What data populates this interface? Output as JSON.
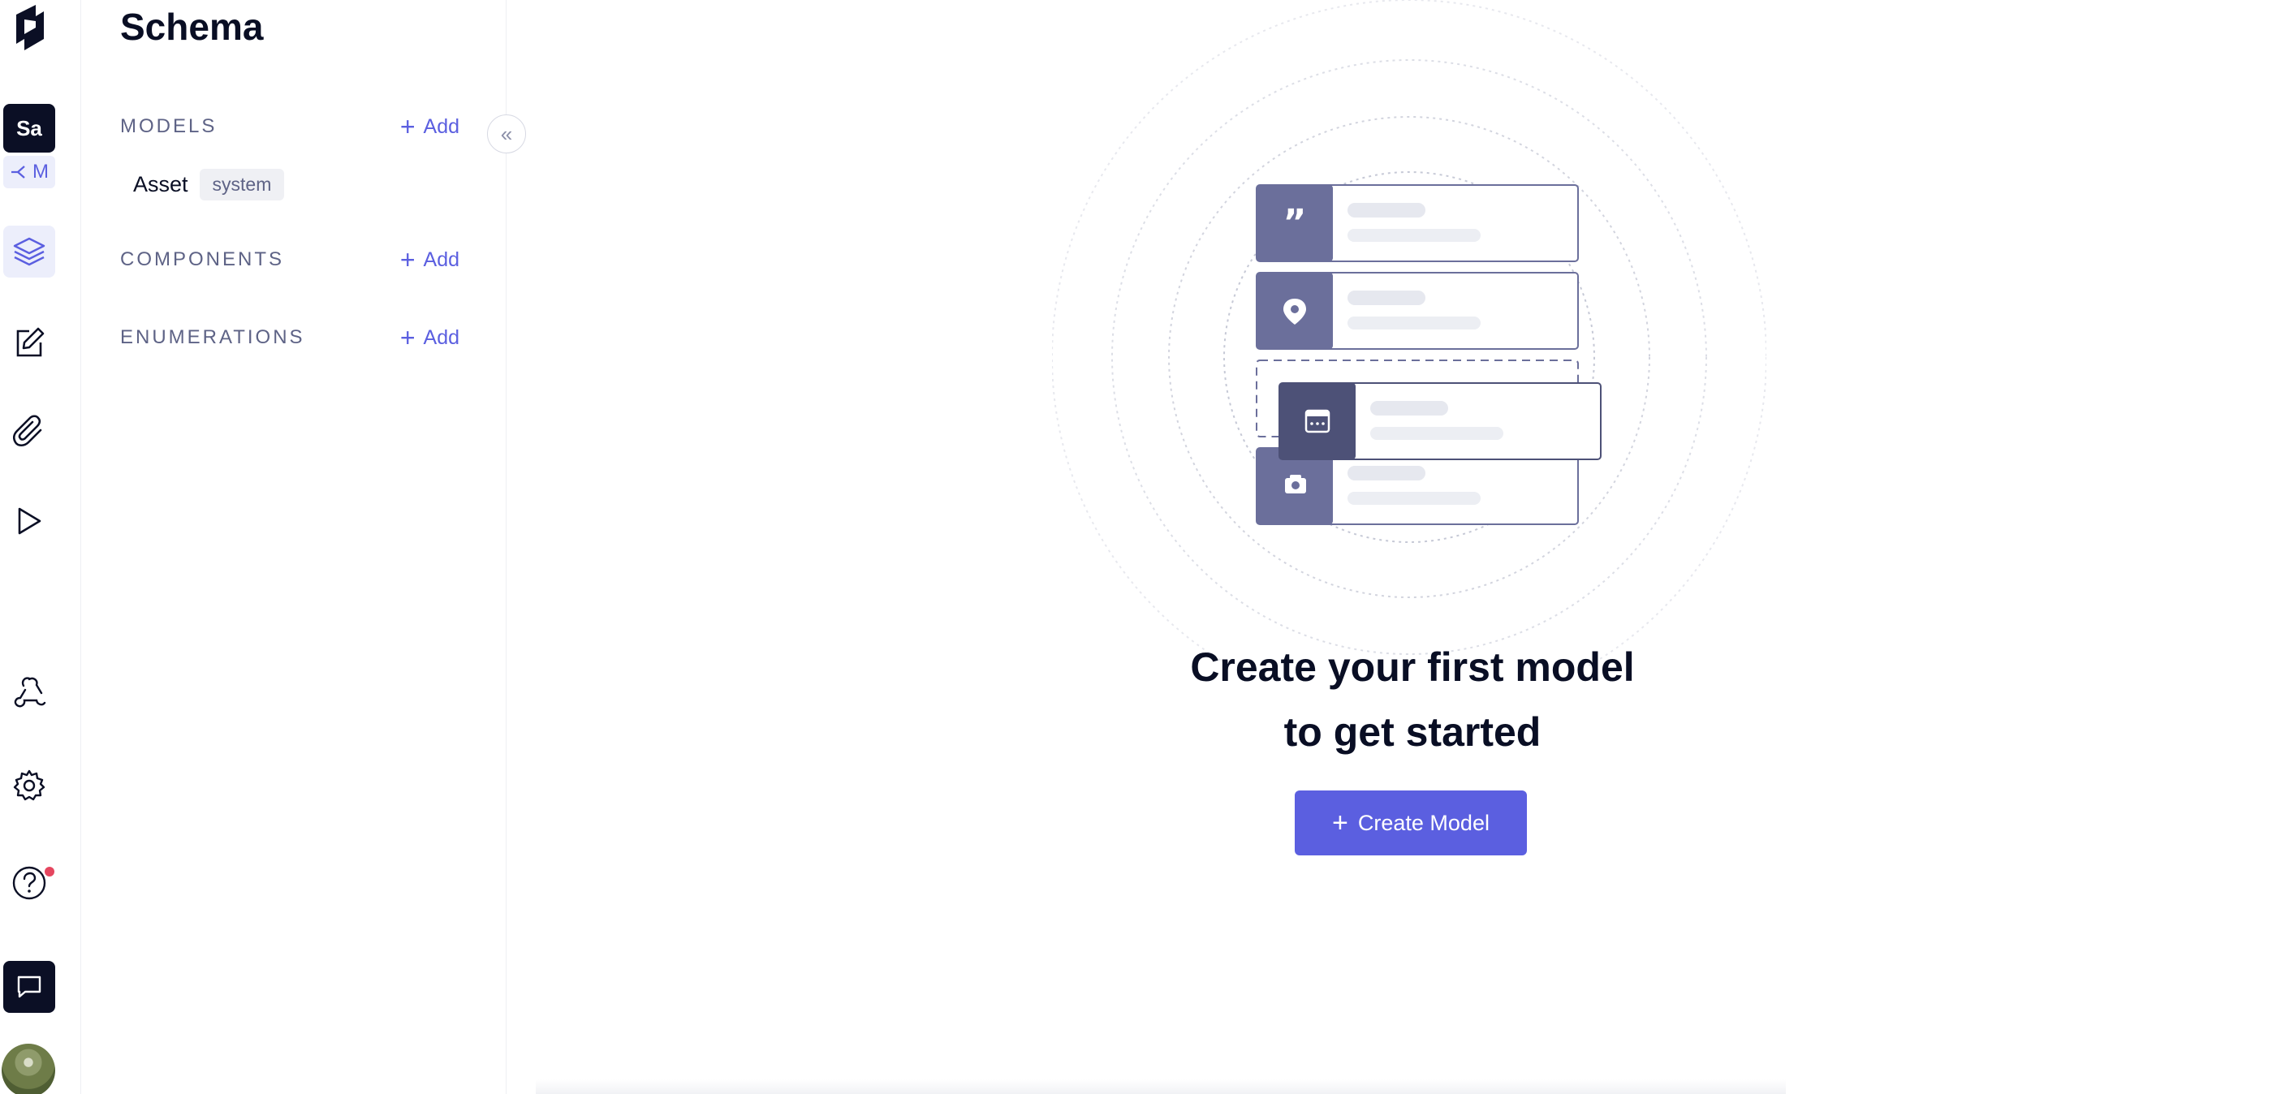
{
  "rail": {
    "project_initials": "Sa",
    "environment_label": "M",
    "icons": [
      "hygraph-logo-icon",
      "schema-layers-icon",
      "content-edit-icon",
      "assets-paperclip-icon",
      "api-playground-icon",
      "webhooks-icon",
      "settings-gear-icon",
      "help-icon",
      "chat-icon"
    ]
  },
  "sidebar": {
    "title": "Schema",
    "sections": [
      {
        "label": "MODELS",
        "add_label": "Add"
      },
      {
        "label": "COMPONENTS",
        "add_label": "Add"
      },
      {
        "label": "ENUMERATIONS",
        "add_label": "Add"
      }
    ],
    "models": [
      {
        "name": "Asset",
        "tag": "system"
      }
    ],
    "collapse_icon": "«"
  },
  "main": {
    "empty_title_line1": "Create your first model",
    "empty_title_line2": "to get started",
    "create_button_label": "Create Model",
    "plus": "+"
  },
  "colors": {
    "accent": "#5b5fe0",
    "dark": "#0b0f25",
    "card_icon": "#6b6f9b",
    "card_icon_active": "#4d5177",
    "notification": "#e5465f"
  }
}
